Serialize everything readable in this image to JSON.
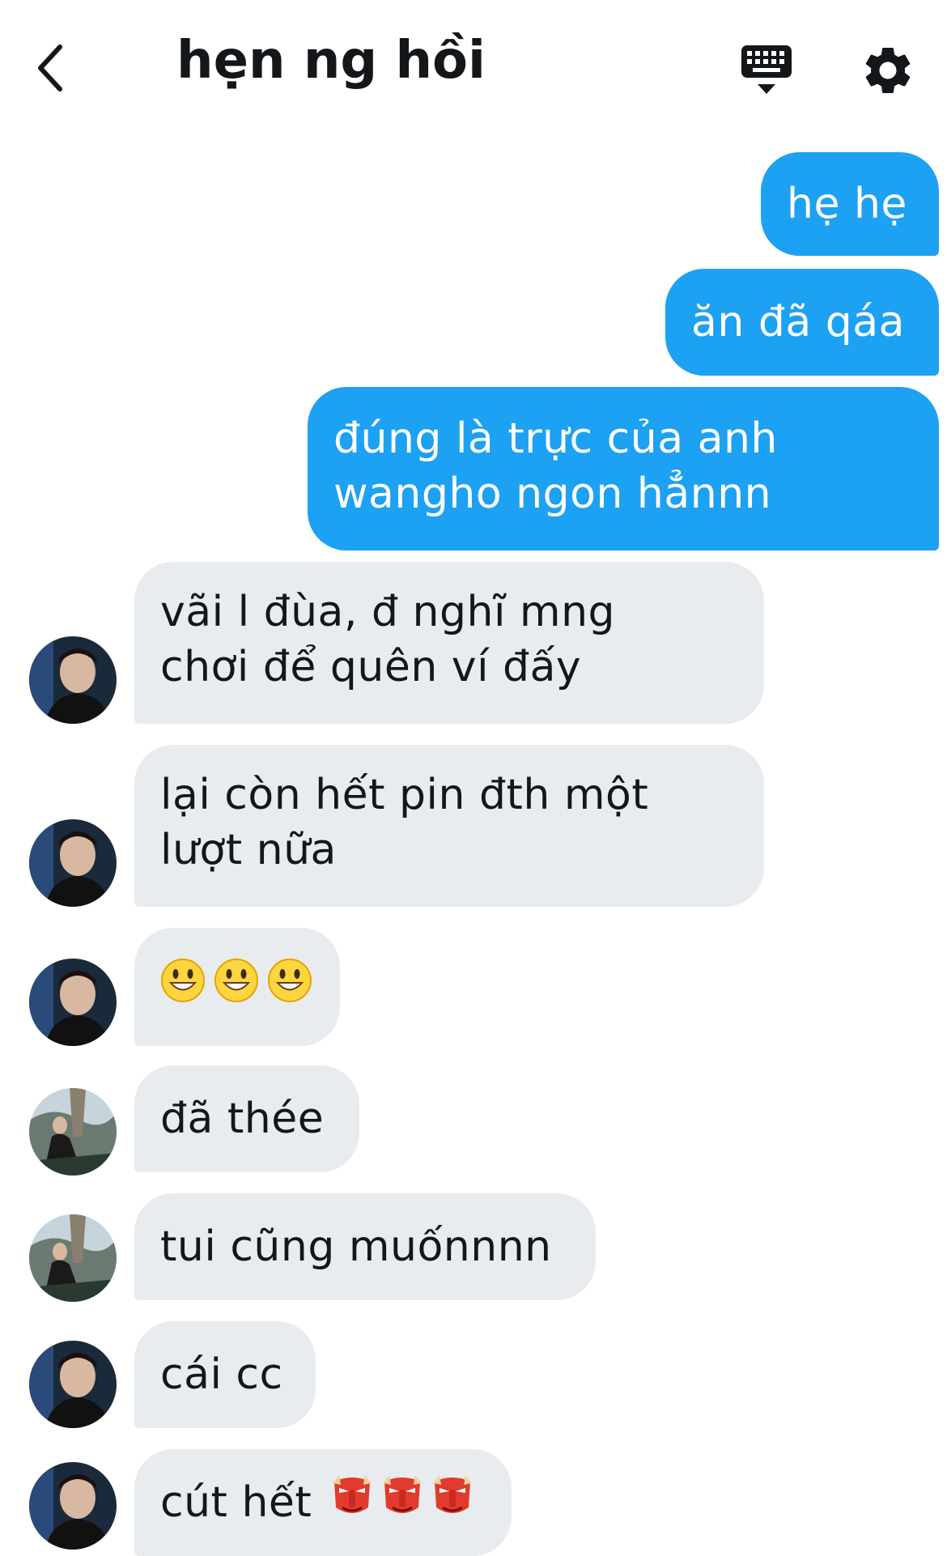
{
  "header": {
    "title": "hẹn ng hồi"
  },
  "messages": {
    "m1": "hẹ hẹ",
    "m2": "ăn đã qáa",
    "m3_line1": "đúng là trực của anh",
    "m3_line2": "wangho ngon hẳnnn",
    "m4_line1": "vãi l đùa, đ nghĩ mng",
    "m4_line2": "chơi để quên ví đấy",
    "m5_line1": "lại còn hết pin đth một",
    "m5_line2": "lượt nữa",
    "m7": "đã thée",
    "m8": "tui cũng muốnnnn",
    "m9": "cái cc",
    "m10": "cút hết"
  },
  "icons": {
    "back": "chevron-left-icon",
    "keyboard": "keyboard-icon",
    "settings": "gear-icon",
    "grin": "grinning-face-emoji",
    "tengu": "goblin-mask-emoji"
  },
  "colors": {
    "sent_bubble": "#1da1f2",
    "received_bubble": "#e8ecef",
    "text": "#14171a"
  }
}
